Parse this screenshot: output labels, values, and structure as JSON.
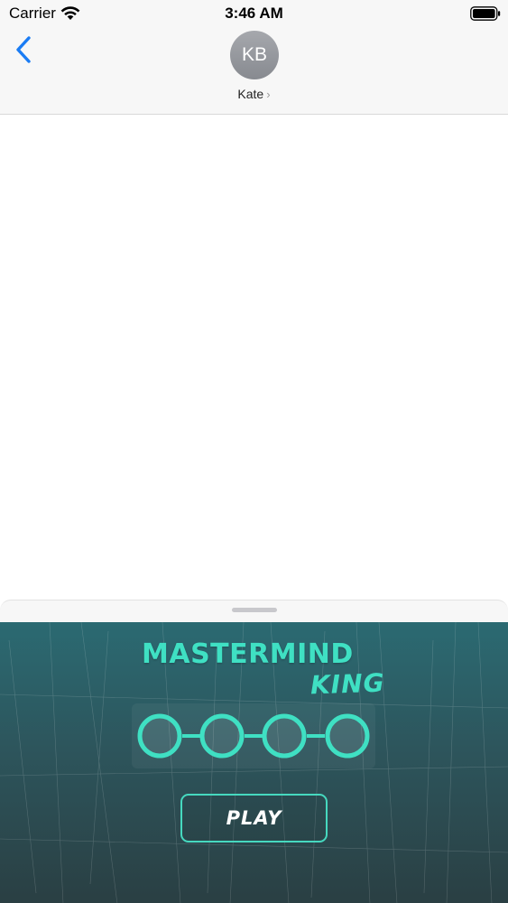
{
  "status_bar": {
    "carrier": "Carrier",
    "time": "3:46 AM",
    "wifi_icon": "wifi-icon",
    "battery_icon": "battery-icon"
  },
  "header": {
    "back_icon": "chevron-left-icon",
    "avatar_initials": "KB",
    "contact_name": "Kate",
    "contact_chevron": "›"
  },
  "game": {
    "title": "MASTERMIND",
    "subtitle": "KING",
    "peg_count": 4,
    "play_label": "PLAY",
    "accent_color": "#3fe0c3"
  }
}
